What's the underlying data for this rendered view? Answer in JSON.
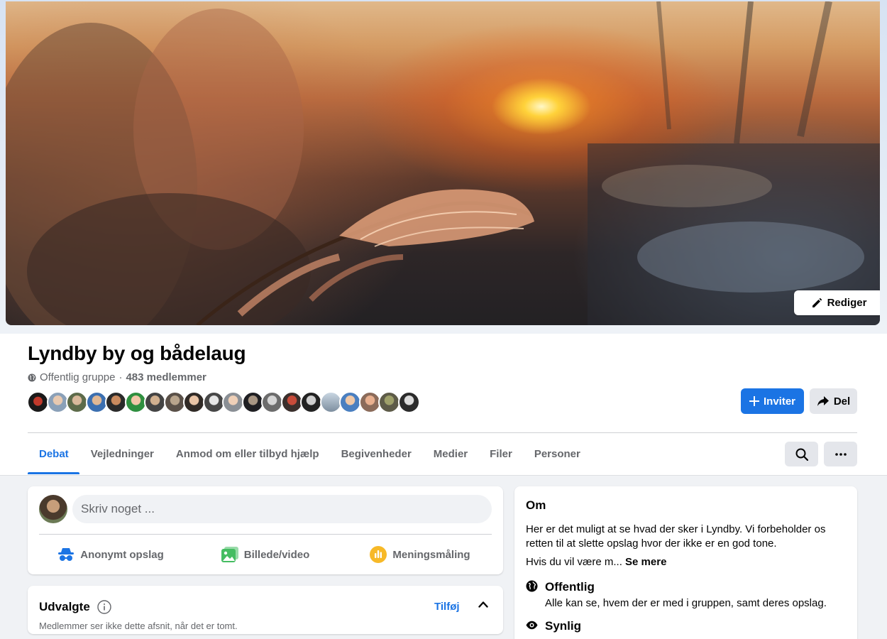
{
  "cover": {
    "edit_label": "Rediger"
  },
  "group": {
    "title": "Lyndby by og bådelaug",
    "privacy": "Offentlig gruppe",
    "separator": "·",
    "member_count": "483 medlemmer",
    "member_avatar_count": 20
  },
  "actions": {
    "invite_label": "Inviter",
    "share_label": "Del"
  },
  "tabs": [
    {
      "label": "Debat",
      "active": true
    },
    {
      "label": "Vejledninger",
      "active": false
    },
    {
      "label": "Anmod om eller tilbyd hjælp",
      "active": false
    },
    {
      "label": "Begivenheder",
      "active": false
    },
    {
      "label": "Medier",
      "active": false
    },
    {
      "label": "Filer",
      "active": false
    },
    {
      "label": "Personer",
      "active": false
    }
  ],
  "composer": {
    "placeholder": "Skriv noget ...",
    "actions": [
      {
        "label": "Anonymt opslag",
        "icon": "incognito-icon",
        "color": "#1b74e4"
      },
      {
        "label": "Billede/video",
        "icon": "photo-icon",
        "color": "#45bd62"
      },
      {
        "label": "Meningsmåling",
        "icon": "poll-icon",
        "color": "#f7b928"
      }
    ]
  },
  "featured": {
    "title": "Udvalgte",
    "add_label": "Tilføj",
    "subtitle": "Medlemmer ser ikke dette afsnit, når det er tomt."
  },
  "about": {
    "title": "Om",
    "description": "Her er det muligt at se hvad der sker i Lyndby. Vi forbeholder os retten til at slette opslag hvor der ikke er en god tone.",
    "truncated": "Hvis du vil være m...",
    "see_more": "Se mere",
    "public_title": "Offentlig",
    "public_text": "Alle kan se, hvem der er med i gruppen, samt deres opslag.",
    "visible_title": "Synlig"
  },
  "colors": {
    "accent": "#1b74e4",
    "muted_text": "#65676b",
    "background": "#f0f2f5"
  }
}
